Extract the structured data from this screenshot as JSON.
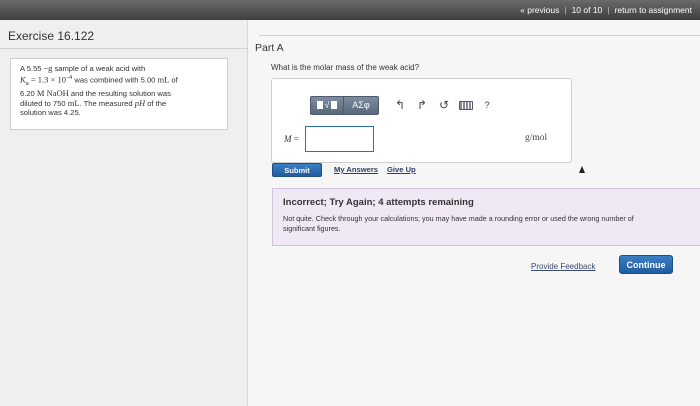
{
  "topbar": {
    "previous": "« previous",
    "counter": "10 of 10",
    "return": "return to assignment"
  },
  "exercise": {
    "title": "Exercise 16.122",
    "problem": {
      "line1_pre": "A 5.55 ",
      "line1_dash": "−",
      "line1_unit": "g",
      "line1_post": " sample of a weak acid with",
      "ka_symbol": "K",
      "ka_sub": "a",
      "ka_eq": " = 1.3 × 10",
      "ka_exp": "−4",
      "line2_post": " was combined with 5.00 ",
      "line2_unit": "mL",
      "line2_end": " of",
      "line3_val": "6.20 ",
      "line3_unit": "M NaOH",
      "line3_post": " and the resulting solution was",
      "line4_pre": "diluted to 750 ",
      "line4_unit": "mL",
      "line4_post": ". The measured ",
      "line4_ph": "pH",
      "line4_end": " of the",
      "line5": "solution was 4.25."
    }
  },
  "part": {
    "label": "Part A",
    "question": "What is the molar mass of the weak acid?"
  },
  "toolbar": {
    "template_label": "√",
    "symbol_label": "ΑΣφ",
    "undo": "↰",
    "redo": "↱",
    "reset": "↺",
    "help": "?"
  },
  "answer": {
    "variable": "M",
    "equals": " =",
    "value": "",
    "unit": "g/mol"
  },
  "actions": {
    "submit": "Submit",
    "my_answers": "My Answers",
    "give_up": "Give Up"
  },
  "feedback": {
    "title": "Incorrect; Try Again; 4 attempts remaining",
    "text": "Not quite. Check through your calculations; you may have made a rounding error or used the wrong number of significant figures."
  },
  "footer": {
    "provide_feedback": "Provide Feedback",
    "continue": "Continue"
  }
}
